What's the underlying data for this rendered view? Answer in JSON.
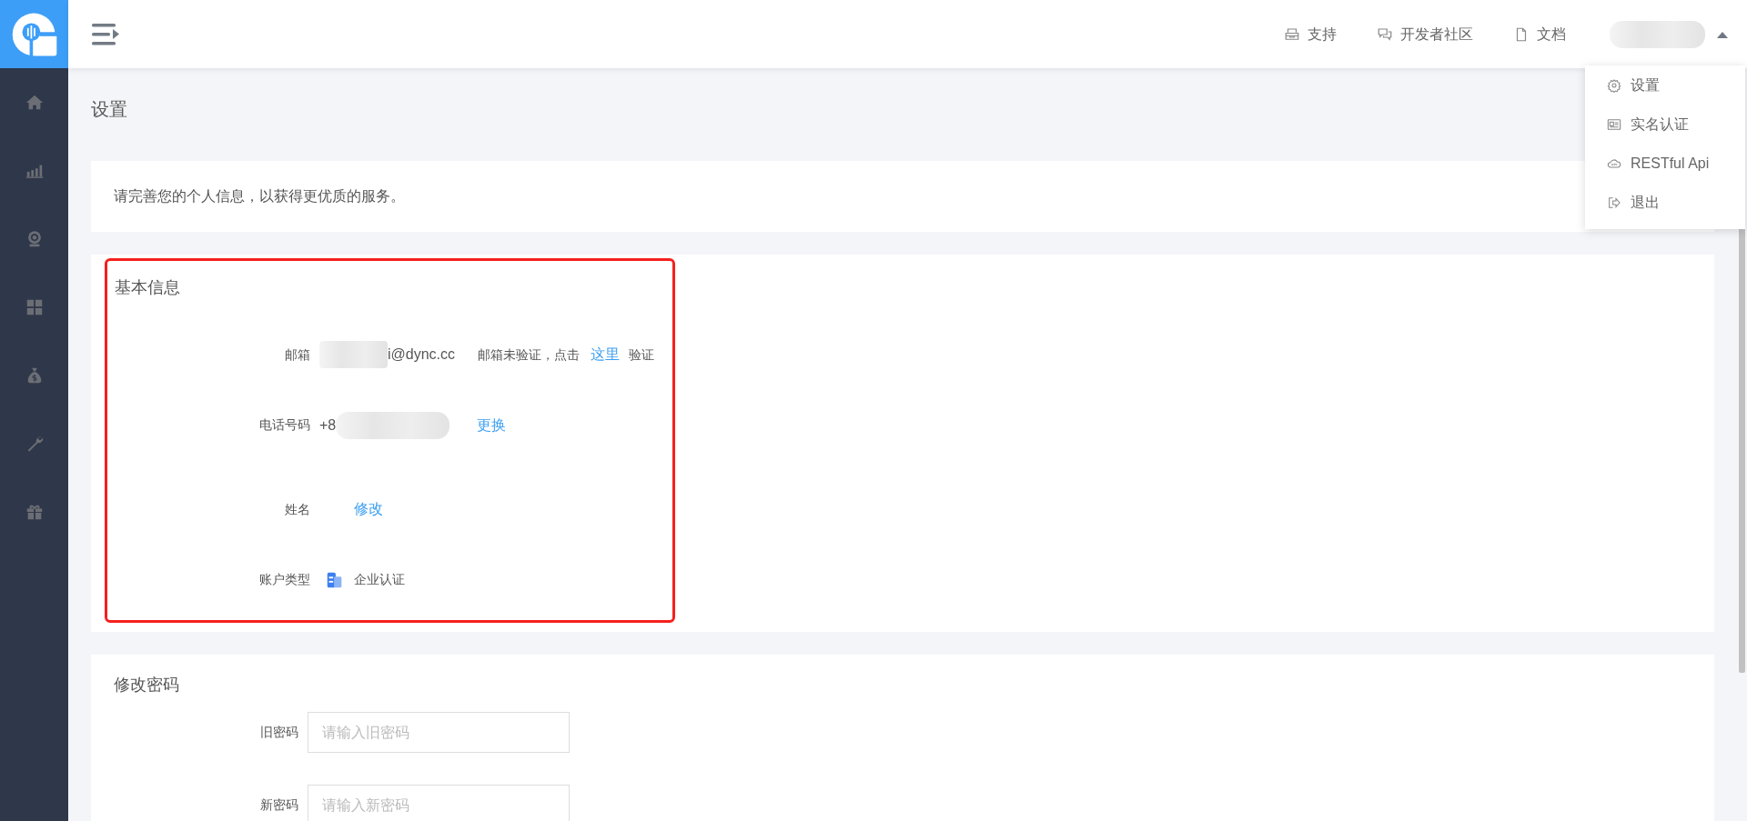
{
  "nav": [
    {
      "label": "支持"
    },
    {
      "label": "开发者社区"
    },
    {
      "label": "文档"
    }
  ],
  "user_menu": {
    "expanded": true,
    "items": [
      {
        "label": "设置"
      },
      {
        "label": "实名认证"
      },
      {
        "label": "RESTful Api"
      },
      {
        "label": "退出"
      }
    ]
  },
  "page_title": "设置",
  "notice": "请完善您的个人信息，以获得更优质的服务。",
  "basic_info": {
    "title": "基本信息",
    "highlighted": true,
    "rows": [
      {
        "kind": "email",
        "label": "邮箱",
        "value": "i@dync.cc",
        "note": "邮箱未验证，点击",
        "link": "这里",
        "note_after": "验证"
      },
      {
        "kind": "phone",
        "label": "电话号码",
        "value": "+8",
        "link": "更换"
      },
      {
        "kind": "name",
        "label": "姓名",
        "link": "修改"
      },
      {
        "kind": "account",
        "label": "账户类型",
        "value": "企业认证"
      }
    ]
  },
  "password": {
    "title": "修改密码",
    "fields": [
      {
        "label": "旧密码",
        "placeholder": "请输入旧密码"
      },
      {
        "label": "新密码",
        "placeholder": "请输入新密码"
      }
    ]
  }
}
